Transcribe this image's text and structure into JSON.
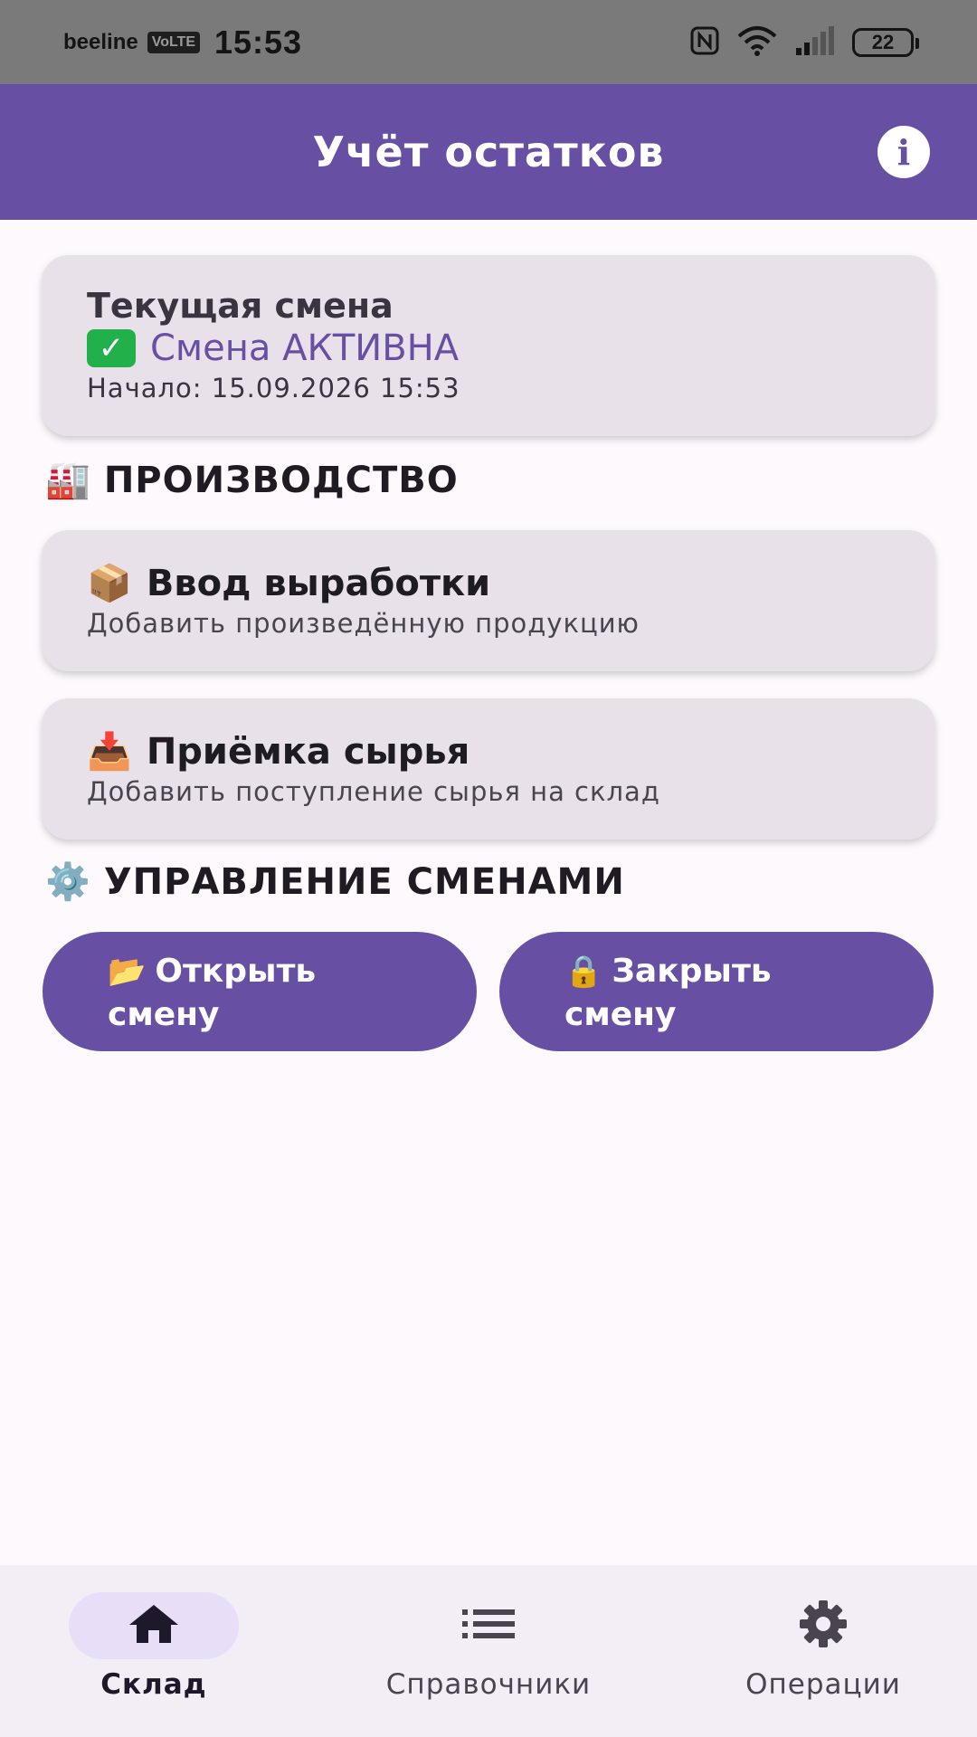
{
  "status_bar": {
    "carrier": "beeline",
    "network_badge": "VoLTE",
    "time": "15:53",
    "battery": "22",
    "icons": [
      "nfc-icon",
      "wifi-icon",
      "signal-icon",
      "battery-icon"
    ]
  },
  "app_bar": {
    "title": "Учёт остатков",
    "info_icon": "info-icon"
  },
  "shift_card": {
    "title": "Текущая смена",
    "status_icon": "check-icon",
    "status": "Смена АКТИВНА",
    "start": "Начало: 15.09.2026 15:53"
  },
  "production": {
    "title": "ПРОИЗВОДСТВО",
    "icon": "factory-icon",
    "actions": [
      {
        "icon": "package-icon",
        "title": "Ввод выработки",
        "subtitle": "Добавить произведённую продукцию"
      },
      {
        "icon": "inbox-tray-icon",
        "title": "Приёмка сырья",
        "subtitle": "Добавить поступление сырья на склад"
      }
    ]
  },
  "shift_management": {
    "title": "УПРАВЛЕНИЕ СМЕНАМИ",
    "icon": "gear-icon",
    "open_button": {
      "icon": "folder-icon",
      "line1": "Открыть",
      "line2": "смену"
    },
    "close_button": {
      "icon": "lock-icon",
      "line1": "Закрыть",
      "line2": "смену"
    }
  },
  "bottom_nav": {
    "items": [
      {
        "label": "Склад",
        "icon": "home-icon",
        "active": true
      },
      {
        "label": "Справочники",
        "icon": "list-icon",
        "active": false
      },
      {
        "label": "Операции",
        "icon": "settings-icon",
        "active": false
      }
    ]
  },
  "colors": {
    "primary": "#6750a4",
    "card_bg": "#e9e1ea",
    "status_bar": "#7a7a7a",
    "success": "#22b04b"
  }
}
